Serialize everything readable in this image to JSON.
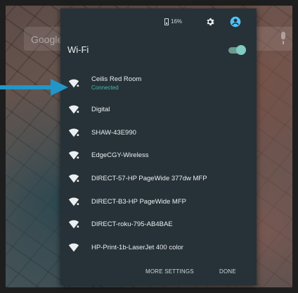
{
  "home": {
    "search_placeholder": "Google"
  },
  "status": {
    "battery": "16%"
  },
  "wifi": {
    "title": "Wi-Fi",
    "enabled": true,
    "networks": [
      {
        "name": "Ceilis Red Room",
        "status": "Connected"
      },
      {
        "name": "Digital"
      },
      {
        "name": "SHAW-43E990"
      },
      {
        "name": "EdgeCGY-Wireless"
      },
      {
        "name": "DIRECT-57-HP PageWide 377dw MFP"
      },
      {
        "name": "DIRECT-B3-HP PageWide MFP"
      },
      {
        "name": "DIRECT-roku-795-AB4BAE"
      },
      {
        "name": "HP-Print-1b-LaserJet 400 color"
      }
    ]
  },
  "actions": {
    "more_settings": "MORE SETTINGS",
    "done": "DONE"
  },
  "colors": {
    "panel": "#263238",
    "accent": "#4db6ac",
    "arrow": "#2196c8"
  }
}
